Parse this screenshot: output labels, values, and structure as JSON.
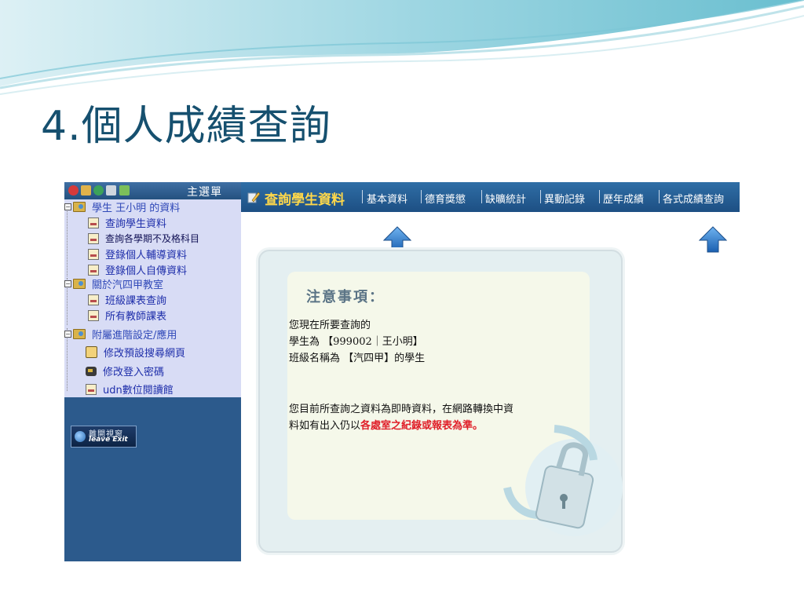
{
  "slide": {
    "title": "4.個人成績查詢"
  },
  "left_menu": {
    "title": "主選單",
    "items": [
      {
        "label": "學生 王小明 的資料"
      },
      {
        "label": "查詢學生資料"
      },
      {
        "label": "查詢各學期不及格科目"
      },
      {
        "label": "登錄個人輔導資料"
      },
      {
        "label": "登錄個人自傳資料"
      },
      {
        "label": "關於汽四甲教室"
      },
      {
        "label": "班級課表查詢"
      },
      {
        "label": "所有教師課表"
      },
      {
        "label": "附屬進階設定/應用"
      },
      {
        "label": "修改預設搜尋網頁"
      },
      {
        "label": "修改登入密碼"
      },
      {
        "label": "udn數位閱讀館"
      }
    ],
    "leave_button": {
      "label_cn": "離開視窗",
      "label_en": "leave Exit"
    }
  },
  "top_nav": {
    "current": "查詢學生資料",
    "tabs": [
      "基本資料",
      "德育獎懲",
      "缺曠統計",
      "異動記錄",
      "歷年成績",
      "各式成績查詢"
    ]
  },
  "notice": {
    "heading": "注意事項：",
    "line1": "您現在所要查詢的",
    "line2": "學生為 【999002｜王小明】",
    "line3": "班級名稱為 【汽四甲】的學生",
    "line4": "您目前所查詢之資料為即時資料，在網路轉換中資",
    "line5_prefix": "料如有出入仍以",
    "line5_highlight": "各處室之紀錄或報表為準。"
  },
  "colors": {
    "title": "#16506f",
    "menu_bg": "#d8dcf5",
    "left_frame_bg": "#2c5a8c",
    "nav_bg": "#2f6ea6",
    "nav_current": "#ffd84a",
    "highlight_red": "#e0202a"
  }
}
